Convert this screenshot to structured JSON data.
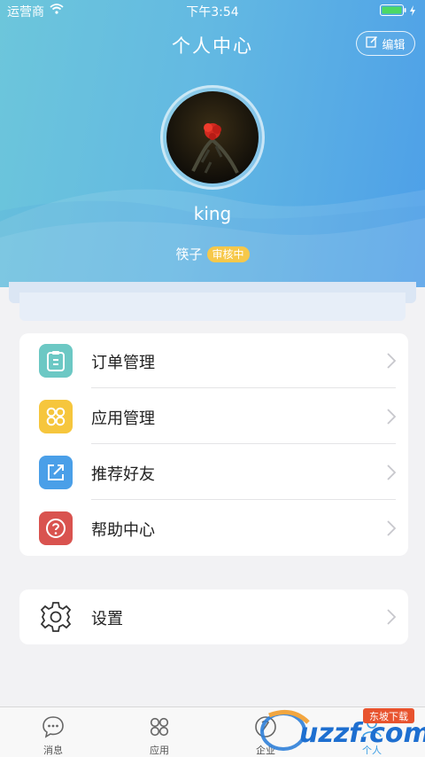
{
  "status_bar": {
    "carrier": "运营商",
    "time": "下午3:54"
  },
  "header": {
    "title": "个人中心",
    "edit_label": "编辑"
  },
  "profile": {
    "username": "king",
    "subtitle": "筷子",
    "status_badge": "审核中"
  },
  "menu": [
    {
      "label": "订单管理",
      "icon": "order-icon",
      "color": "#6cc8c4"
    },
    {
      "label": "应用管理",
      "icon": "apps-icon",
      "color": "#f6c63d"
    },
    {
      "label": "推荐好友",
      "icon": "share-icon",
      "color": "#4a9fe8"
    },
    {
      "label": "帮助中心",
      "icon": "help-icon",
      "color": "#d9534f"
    }
  ],
  "settings": {
    "label": "设置",
    "icon": "gear-icon"
  },
  "tabbar": {
    "active": "个人",
    "items": [
      {
        "label": "消息",
        "icon": "message-icon"
      },
      {
        "label": "应用",
        "icon": "apps-icon"
      },
      {
        "label": "企业",
        "icon": "company-icon"
      },
      {
        "label": "个人",
        "icon": "person-icon"
      }
    ]
  },
  "watermark": {
    "text": "uzzf.com",
    "tag": "东坡下载"
  }
}
